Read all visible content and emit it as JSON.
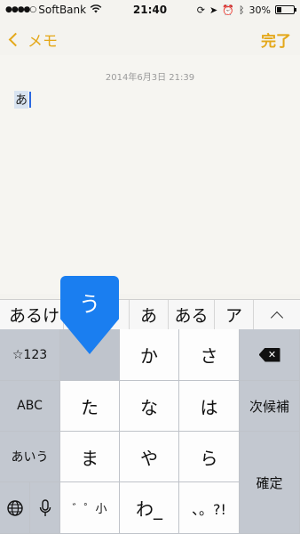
{
  "status_bar": {
    "signal": "●●●●○",
    "carrier": "SoftBank",
    "wifi_icon": "wifi-icon",
    "time": "21:40",
    "battery_percent": "30%",
    "battery_level": 0.3
  },
  "nav": {
    "back_label": "メモ",
    "done_label": "完了",
    "accent_color": "#e4a81a"
  },
  "note": {
    "date": "2014年6月3日 21:39",
    "text": "あ"
  },
  "candidates": {
    "items": [
      "あるけ",
      "",
      "あ",
      "ある",
      "ア"
    ]
  },
  "popup": {
    "char": "う"
  },
  "keyboard": {
    "rows": {
      "r1": {
        "symbols": "☆123",
        "ka": "か",
        "sa": "さ"
      },
      "r2": {
        "abc": "ABC",
        "ta": "た",
        "na": "な",
        "ha": "は",
        "next": "次候補"
      },
      "r3": {
        "aiu": "あいう",
        "ma": "ま",
        "ya": "や",
        "ra": "ら",
        "confirm": "確定"
      },
      "r4": {
        "dakuten": "゛゜小",
        "wa": "わ_",
        "punct": "、。?!"
      }
    }
  }
}
